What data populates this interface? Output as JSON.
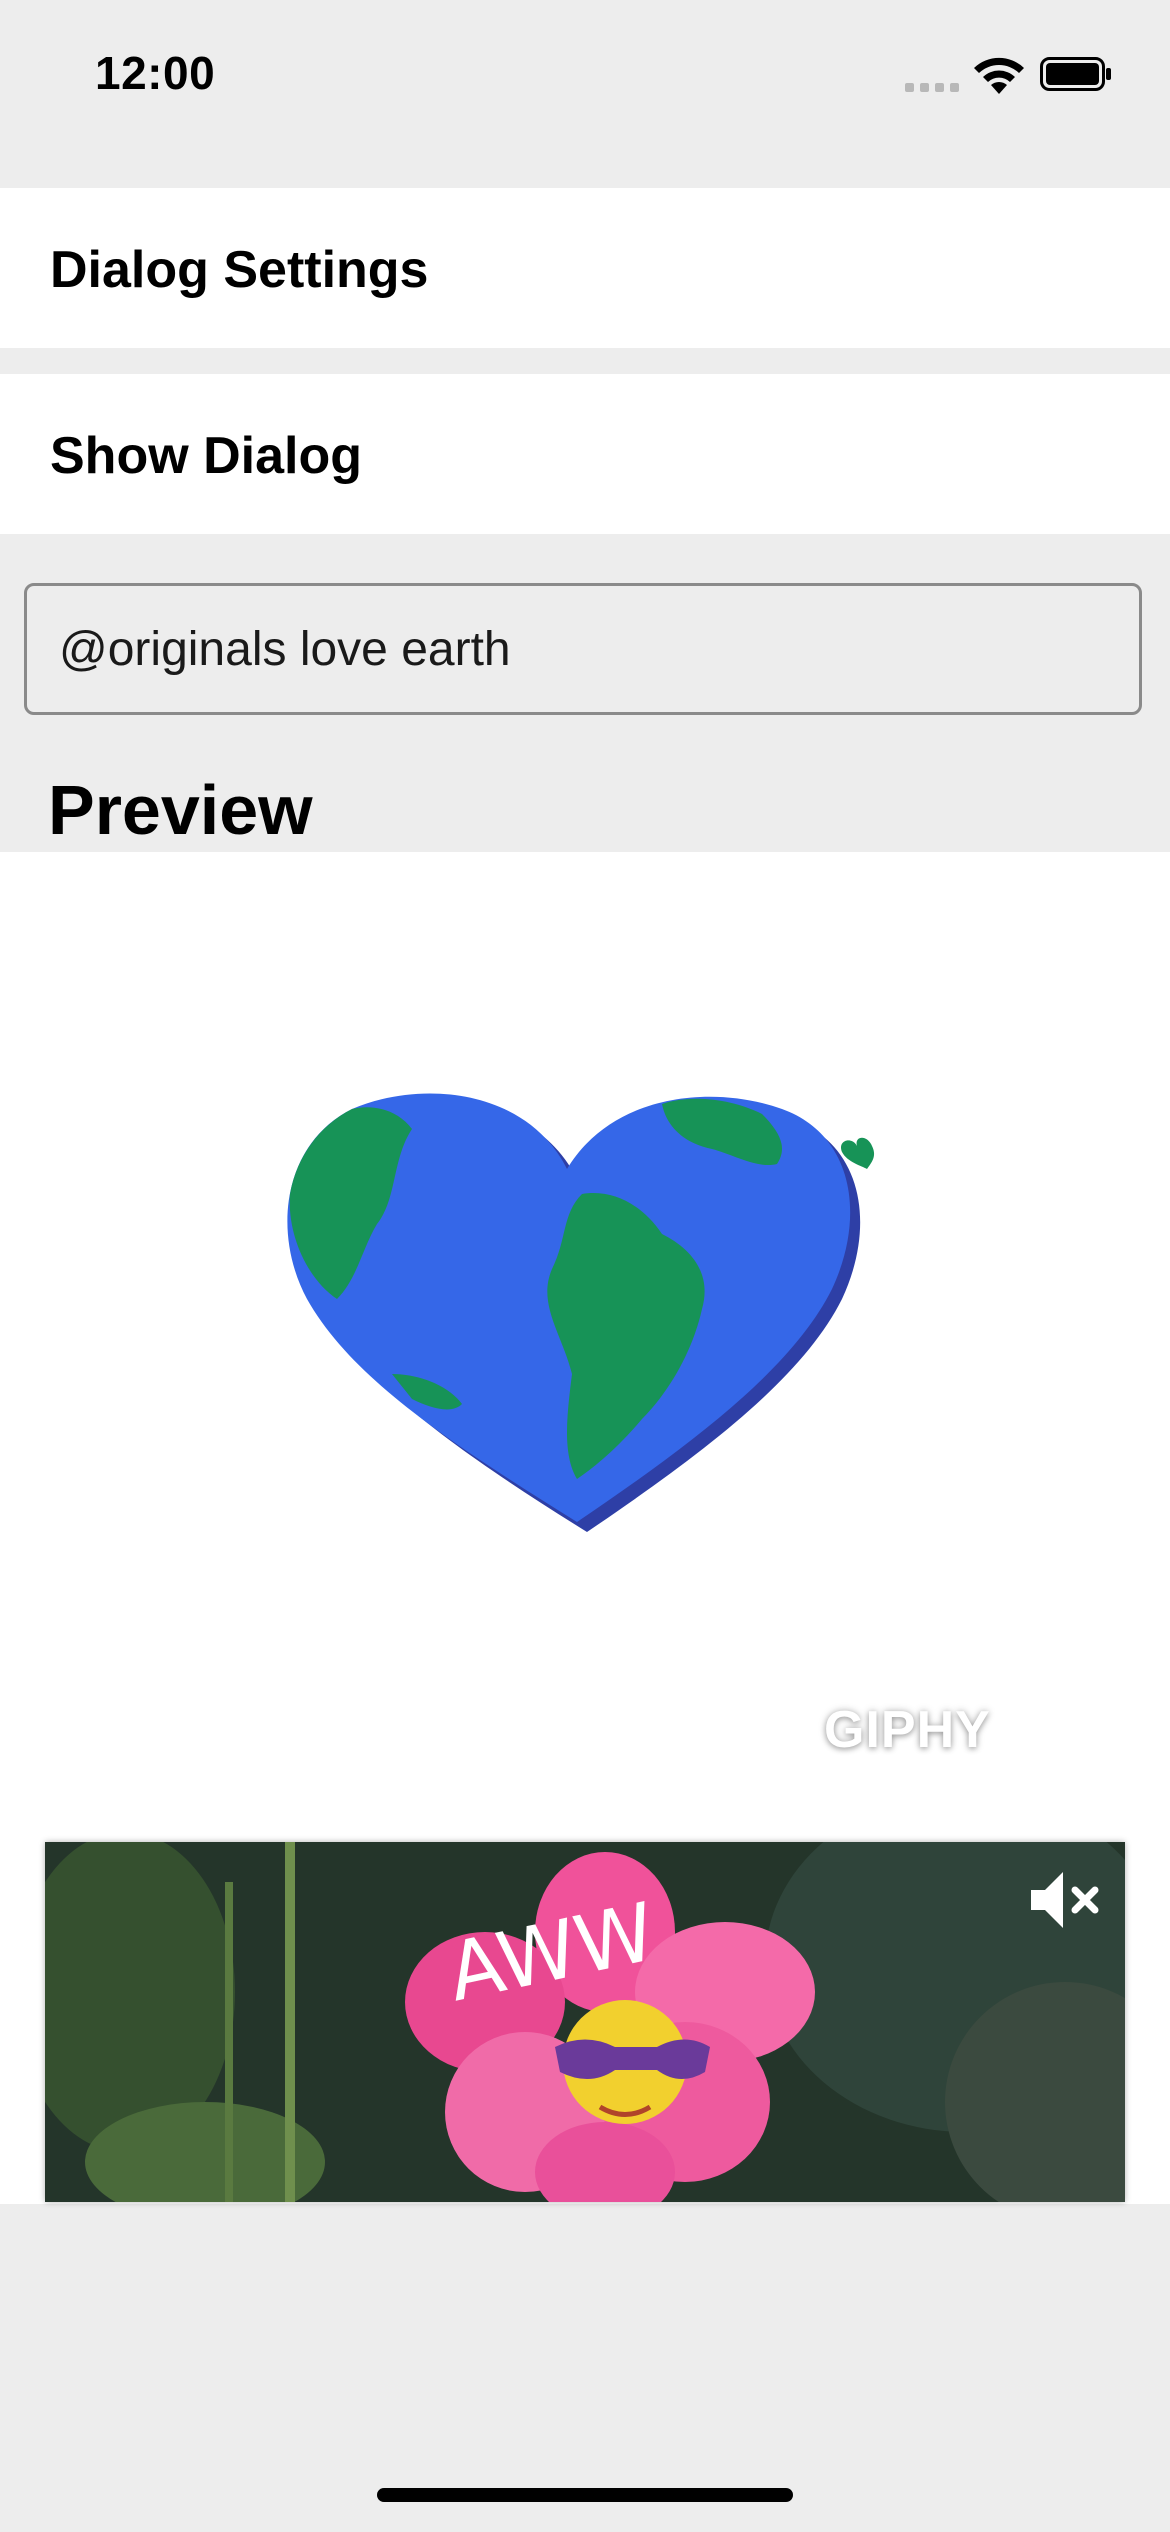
{
  "status_bar": {
    "time": "12:00",
    "icons": [
      "cellular-signal-icon",
      "wifi-icon",
      "battery-icon"
    ]
  },
  "menu": {
    "dialog_settings": "Dialog Settings",
    "show_dialog": "Show Dialog"
  },
  "search": {
    "value": "@originals love earth"
  },
  "preview": {
    "title": "Preview",
    "watermark": "GIPHY",
    "video_caption": "AWW",
    "video_icon": "speaker-muted-icon"
  },
  "colors": {
    "background": "#ededed",
    "surface": "#ffffff",
    "earth_ocean": "#3567e8",
    "earth_land": "#179357",
    "flower_pink": "#f0529a"
  }
}
